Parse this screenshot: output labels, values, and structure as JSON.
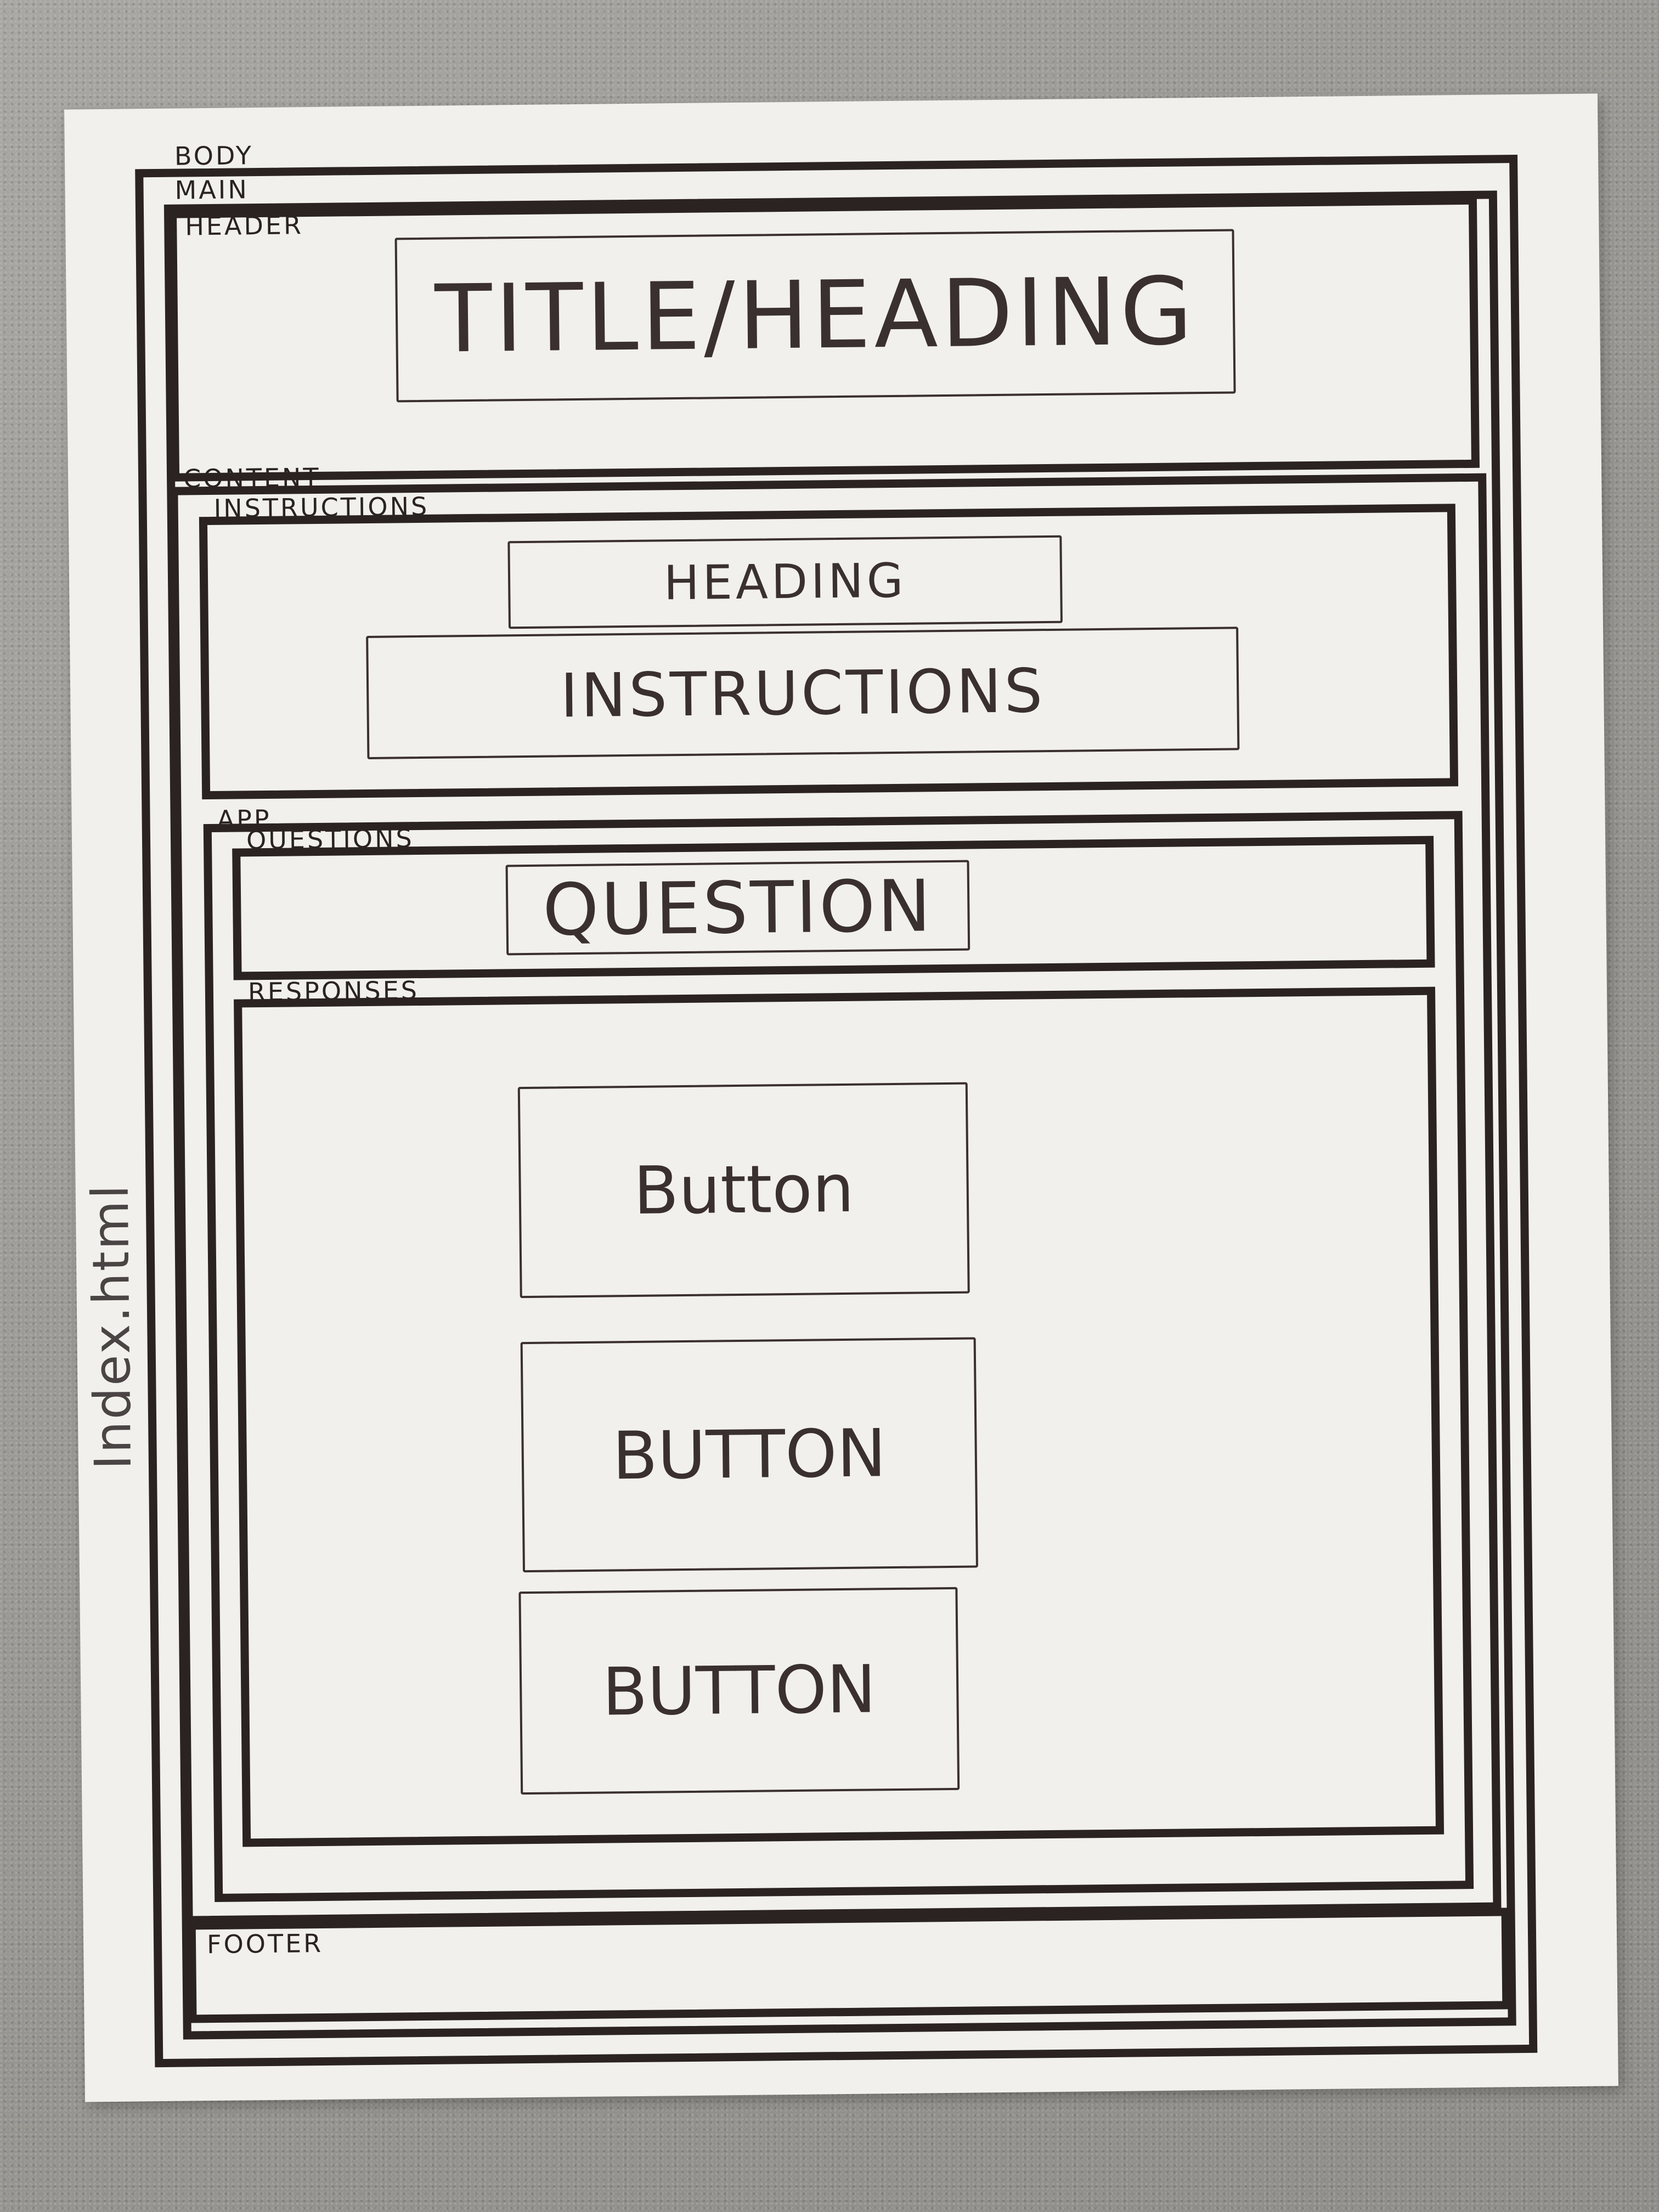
{
  "page_label": "Index.html",
  "body": {
    "label": "BODY"
  },
  "main": {
    "label": "MAIN"
  },
  "header": {
    "label": "HEADER",
    "title": "TITLE/HEADING"
  },
  "content": {
    "label": "CONTENT",
    "instructions": {
      "label": "INSTRUCTIONS",
      "heading": "HEADING",
      "text": "INSTRUCTIONS"
    },
    "app": {
      "label": "APP",
      "questions": {
        "label": "QUESTIONS",
        "question": "QUESTION"
      },
      "responses": {
        "label": "RESPONSES",
        "buttons": [
          "Button",
          "BUTTON",
          "BUTTON"
        ]
      }
    }
  },
  "footer": {
    "label": "FOOTER"
  }
}
